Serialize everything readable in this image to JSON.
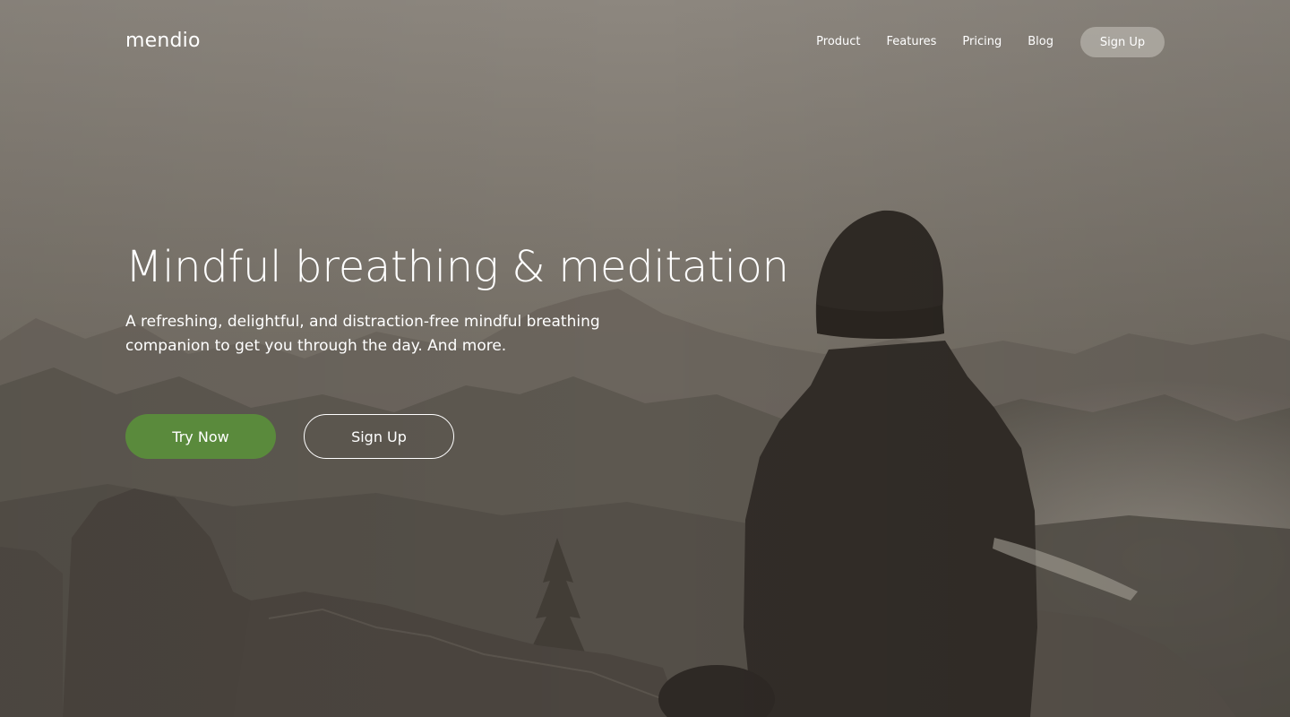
{
  "brand": {
    "logo_text": "mendio"
  },
  "nav": {
    "links": [
      {
        "label": "Product"
      },
      {
        "label": "Features"
      },
      {
        "label": "Pricing"
      },
      {
        "label": "Blog"
      }
    ],
    "signup_label": "Sign Up"
  },
  "hero": {
    "headline": "Mindful breathing & meditation",
    "subtitle": "A refreshing, delightful, and distraction-free mindful breathing companion to get you through the day. And more.",
    "primary_cta": "Try Now",
    "secondary_cta": "Sign Up"
  },
  "colors": {
    "accent_green": "#5a8a3c",
    "text": "#ffffff",
    "nav_button_bg": "#c8c4be"
  }
}
